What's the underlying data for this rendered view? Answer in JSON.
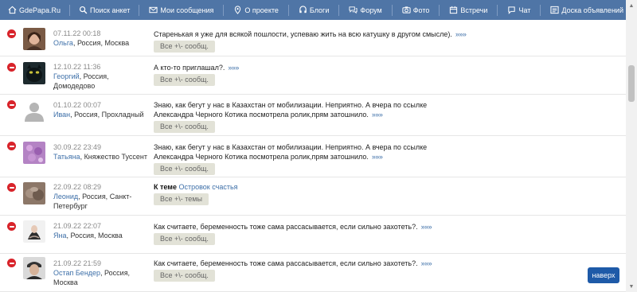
{
  "nav": {
    "items": [
      {
        "label": "GdePapa.Ru",
        "icon": "home-icon"
      },
      {
        "label": "Поиск анкет",
        "icon": "search-icon"
      },
      {
        "label": "Мои сообщения",
        "icon": "envelope-icon"
      },
      {
        "label": "О проекте",
        "icon": "location-pin-icon"
      },
      {
        "label": "Блоги",
        "icon": "blog-icon"
      },
      {
        "label": "Форум",
        "icon": "forum-icon"
      },
      {
        "label": "Фото",
        "icon": "camera-icon"
      },
      {
        "label": "Встречи",
        "icon": "calendar-icon"
      },
      {
        "label": "Чат",
        "icon": "chat-icon"
      },
      {
        "label": "Доска объявлений",
        "icon": "board-icon"
      }
    ]
  },
  "feed": [
    {
      "date": "07.11.22 00:18",
      "name": "Ольга",
      "place": ", Россия, Москва",
      "text": "Старенькая я уже для всякой пошлости, успеваю жить на всю катушку в другом смысле).",
      "more": "»»»",
      "button": "Все +\\- сообщ."
    },
    {
      "date": "12.10.22 11:36",
      "name": "Георгий",
      "place": ", Россия, Домодедово",
      "text": "А кто-то приглашал?.",
      "more": "»»»",
      "button": "Все +\\- сообщ."
    },
    {
      "date": "01.10.22 00:07",
      "name": "Иван",
      "place": ", Россия, Прохладный",
      "text": "Знаю, как бегут у нас в Казахстан от мобилизации. Неприятно. А вчера по ссылке Александра Черного Котика посмотрела ролик,прям затошнило.",
      "more": "»»»",
      "button": "Все +\\- сообщ."
    },
    {
      "date": "30.09.22 23:49",
      "name": "Татьяна",
      "place": ", Княжество Туссент",
      "text": "Знаю, как бегут у нас в Казахстан от мобилизации. Неприятно. А вчера по ссылке Александра Черного Котика посмотрела ролик,прям затошнило.",
      "more": "»»»",
      "button": "Все +\\- сообщ."
    },
    {
      "date": "22.09.22 08:29",
      "name": "Леонид",
      "place": ", Россия, Санкт-Петербург",
      "theme_label": "К теме",
      "theme_link": "Островок счастья",
      "button": "Все +\\- темы"
    },
    {
      "date": "21.09.22 22:07",
      "name": "Яна",
      "place": ", Россия, Москва",
      "text": "Как считаете, беременность тоже сама рассасывается, если сильно захотеть?.",
      "more": "»»»",
      "button": "Все +\\- сообщ."
    },
    {
      "date": "21.09.22 21:59",
      "name": "Остап Бендер",
      "place": ", Россия, Москва",
      "text": "Как считаете, беременность тоже сама рассасывается, если сильно захотеть?.",
      "more": "»»»",
      "button": "Все +\\- сообщ."
    }
  ],
  "to_top": "наверх",
  "colors": {
    "nav_bg": "#4f75a6",
    "link": "#3d6fa8",
    "delete": "#d8232a",
    "button_bg": "#e2e2d7",
    "to_top_bg": "#1e5aa8"
  }
}
